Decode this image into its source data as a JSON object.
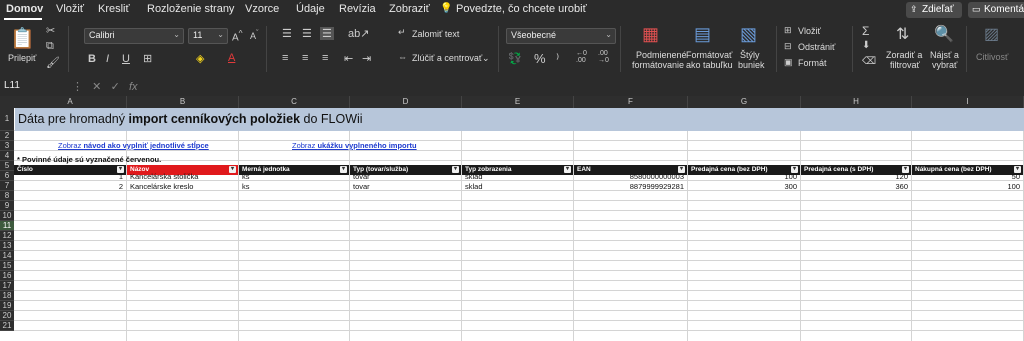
{
  "menu": {
    "tabs": [
      "Domov",
      "Vložiť",
      "Kresliť",
      "Rozloženie strany",
      "Vzorce",
      "Údaje",
      "Revízia",
      "Zobraziť"
    ],
    "tell_me": "Povedzte, čo chcete urobiť",
    "share": "Zdieľať",
    "comments": "Komentáre"
  },
  "ribbon": {
    "paste": "Prilepiť",
    "font": "Calibri",
    "font_size": "11",
    "wrap_text": "Zalomiť text",
    "merge_center": "Zlúčiť a centrovať",
    "number_format": "Všeobecné",
    "conditional_formatting_1": "Podmienené",
    "conditional_formatting_2": "formátovanie",
    "format_table_1": "Formátovať",
    "format_table_2": "ako tabuľku",
    "cell_styles_1": "Štýly",
    "cell_styles_2": "buniek",
    "insert": "Vložiť",
    "delete": "Odstrániť",
    "format": "Formát",
    "sort_filter_1": "Zoradiť a",
    "sort_filter_2": "filtrovať",
    "find_select_1": "Nájsť a",
    "find_select_2": "vybrať",
    "sensitivity": "Citlivosť"
  },
  "formula_bar": {
    "name_box": "L11",
    "fx": "fx"
  },
  "sheet": {
    "columns": [
      "A",
      "B",
      "C",
      "D",
      "E",
      "F",
      "G",
      "H",
      "I"
    ],
    "rows": [
      "1",
      "2",
      "3",
      "4",
      "5",
      "6",
      "7",
      "8",
      "9",
      "10",
      "11",
      "12",
      "13",
      "14",
      "15",
      "16",
      "17",
      "18",
      "19",
      "20",
      "21"
    ],
    "selected_row": "11",
    "title_prefix": "Dáta pre hromadný ",
    "title_bold": "import cenníkových položiek",
    "title_suffix": " do FLOWii",
    "link1_prefix": "Zobraz ",
    "link1_bold": "návod ako vyplniť jednotlivé stĺpce",
    "link2_prefix": "Zobraz ",
    "link2_bold": "ukážku vyplneného importu",
    "note": "* Povinné údaje sú vyznačené červenou.",
    "headers": [
      "Číslo",
      "Názov",
      "Merná jednotka",
      "Typ (tovar/služba)",
      "Typ zobrazenia",
      "EAN",
      "Predajná cena (bez DPH)",
      "Predajná cena (s DPH)",
      "Nákupná cena (bez DPH)"
    ],
    "data": [
      [
        "1",
        "Kancelárska stolička",
        "ks",
        "tovar",
        "sklad",
        "8580000000003",
        "100",
        "120",
        "50"
      ],
      [
        "2",
        "Kancelárske kreslo",
        "ks",
        "tovar",
        "sklad",
        "8879999929281",
        "300",
        "360",
        "100"
      ]
    ]
  },
  "colors": {
    "title_band": "#b7c6da",
    "header_dark": "#1a1a1a",
    "header_required": "#e0191c",
    "link": "#1f3ccf"
  }
}
